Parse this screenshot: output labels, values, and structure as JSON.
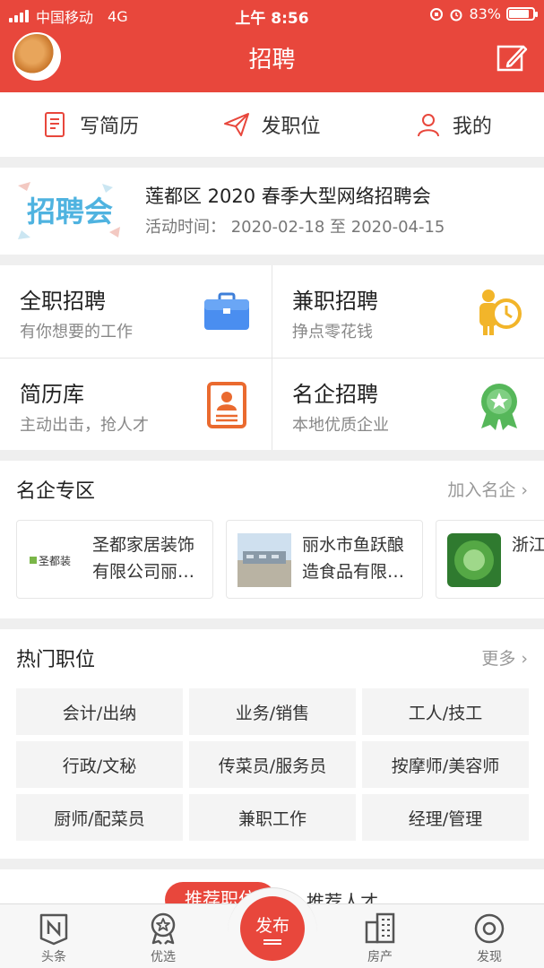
{
  "status_bar": {
    "carrier": "中国移动",
    "network": "4G",
    "time": "上午 8:56",
    "battery": "83%"
  },
  "header": {
    "title": "招聘"
  },
  "tabs": [
    {
      "label": "写简历",
      "icon": "resume-icon"
    },
    {
      "label": "发职位",
      "icon": "paper-plane-icon"
    },
    {
      "label": "我的",
      "icon": "person-icon"
    }
  ],
  "event": {
    "logo_text": "招聘会",
    "title": "莲都区 2020 春季大型网络招聘会",
    "time": "活动时间：  2020-02-18 至 2020-04-15"
  },
  "categories": [
    {
      "title": "全职招聘",
      "subtitle": "有你想要的工作",
      "icon": "briefcase-icon"
    },
    {
      "title": "兼职招聘",
      "subtitle": "挣点零花钱",
      "icon": "parttime-clock-icon"
    },
    {
      "title": "简历库",
      "subtitle": "主动出击，抢人才",
      "icon": "resume-card-icon"
    },
    {
      "title": "名企招聘",
      "subtitle": "本地优质企业",
      "icon": "award-badge-icon"
    }
  ],
  "famous": {
    "title": "名企专区",
    "more": "加入名企",
    "companies": [
      {
        "name": "圣都家居装饰有限公司丽…",
        "logo_text": "圣都装"
      },
      {
        "name": "丽水市鱼跃酿造食品有限…",
        "logo_text": ""
      },
      {
        "name": "浙江科技",
        "logo_text": ""
      }
    ]
  },
  "hot": {
    "title": "热门职位",
    "more": "更多",
    "jobs": [
      "会计/出纳",
      "业务/销售",
      "工人/技工",
      "行政/文秘",
      "传菜员/服务员",
      "按摩师/美容师",
      "厨师/配菜员",
      "兼职工作",
      "经理/管理"
    ]
  },
  "recommend": {
    "active": "推荐职位",
    "other": "推荐人才"
  },
  "tabbar": {
    "items": [
      "头条",
      "优选",
      "房产",
      "发现"
    ],
    "publish": "发布"
  },
  "colors": {
    "brand_red": "#e8473c",
    "background": "#efefef"
  }
}
